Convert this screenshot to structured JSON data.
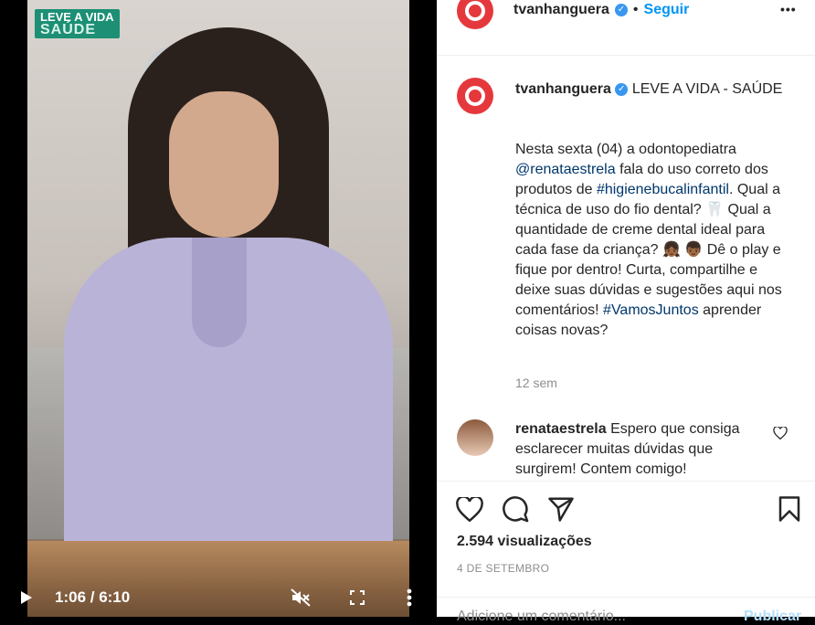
{
  "video": {
    "badge_line1": "LEVE A VIDA",
    "badge_line2": "SAÚDE",
    "time_display": "1:06 / 6:10",
    "icons": [
      "play-icon",
      "mute-icon",
      "fullscreen-icon",
      "more-vertical-icon"
    ]
  },
  "header": {
    "username": "tvanhanguera",
    "separator": "•",
    "follow_label": "Seguir",
    "more_label": "•••"
  },
  "caption": {
    "username": "tvanhanguera",
    "title": "LEVE A VIDA - SAÚDE",
    "p1": "Nesta sexta (04) a odontopediatra",
    "mention": "@renataestrela",
    "p2": " fala do uso correto dos produtos de ",
    "hashtag1": "#higienebucalinfantil",
    "p3": ". Qual a técnica de uso do fio dental? ",
    "tooth_emoji": "🦷",
    "p4": " Qual a quantidade de creme dental ideal para cada fase da criança? ",
    "emoji_child1": "👧🏾",
    "emoji_child2": "👦🏾",
    "p5": " Dê o play e fique por dentro! Curta, compartilhe e deixe suas dúvidas e sugestões aqui nos comentários!",
    "hashtag2": "#VamosJuntos",
    "p6": " aprender coisas novas?",
    "time_ago": "12 sem"
  },
  "comment": {
    "username": "renataestrela",
    "text": " Espero que consiga esclarecer muitas dúvidas que surgirem! Contem comigo!"
  },
  "stats": {
    "views": "2.594 visualizações",
    "date": "4 DE SETEMBRO"
  },
  "add_comment": {
    "placeholder": "Adicione um comentário...",
    "publish_label": "Publicar"
  },
  "colors": {
    "accent": "#0095f6",
    "brand": "#e5383d",
    "badge": "#1c8f74"
  }
}
